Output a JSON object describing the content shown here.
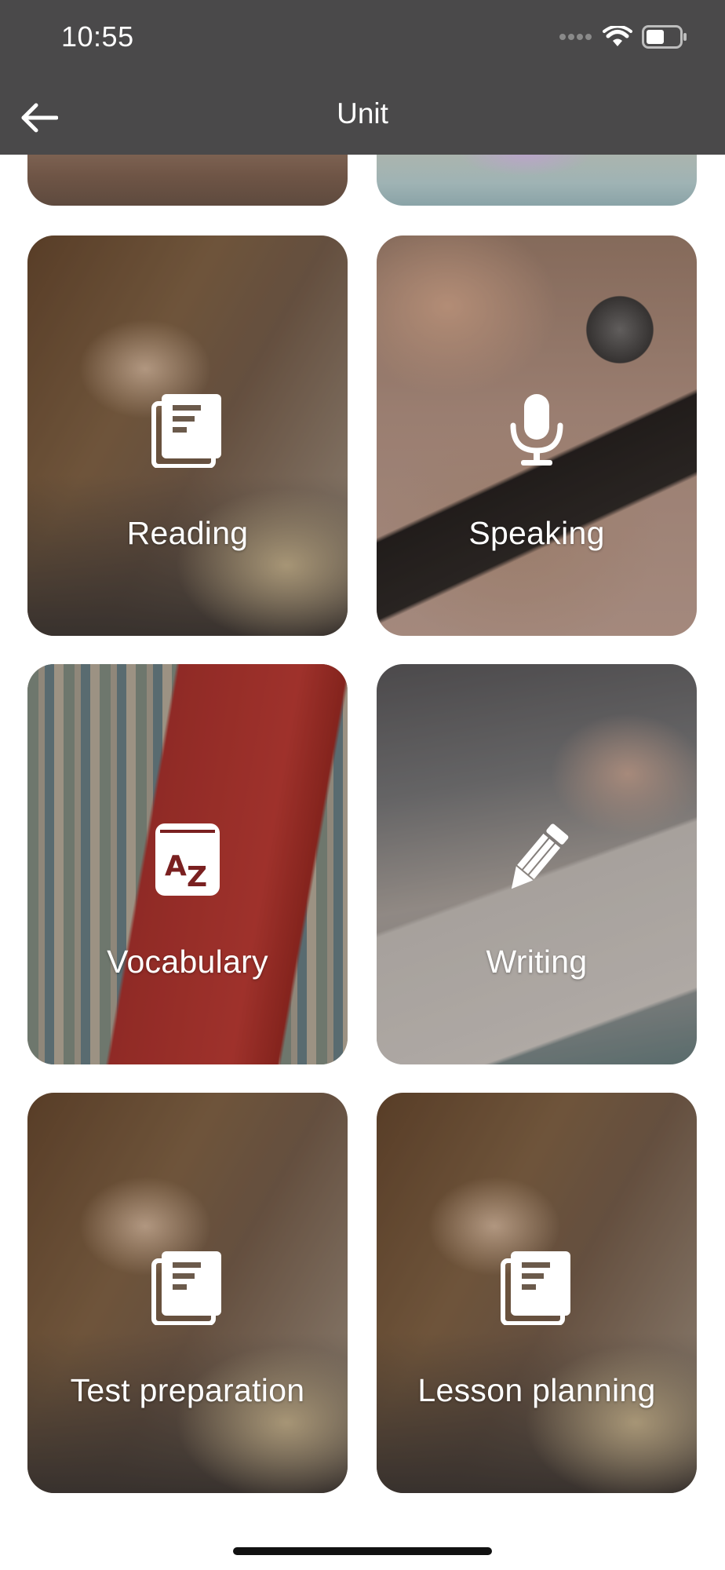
{
  "status_bar": {
    "time": "10:55"
  },
  "nav": {
    "title": "Unit",
    "back_icon": "arrow-left-icon"
  },
  "cards": [
    {
      "label": "Reading",
      "icon": "book-icon"
    },
    {
      "label": "Speaking",
      "icon": "microphone-icon"
    },
    {
      "label": "Vocabulary",
      "icon": "dictionary-az-icon"
    },
    {
      "label": "Writing",
      "icon": "pencil-icon"
    },
    {
      "label": "Test preparation",
      "icon": "book-icon"
    },
    {
      "label": "Lesson planning",
      "icon": "book-icon"
    }
  ],
  "colors": {
    "header_bg": "#4a494a",
    "text_on_image": "#ffffff"
  }
}
